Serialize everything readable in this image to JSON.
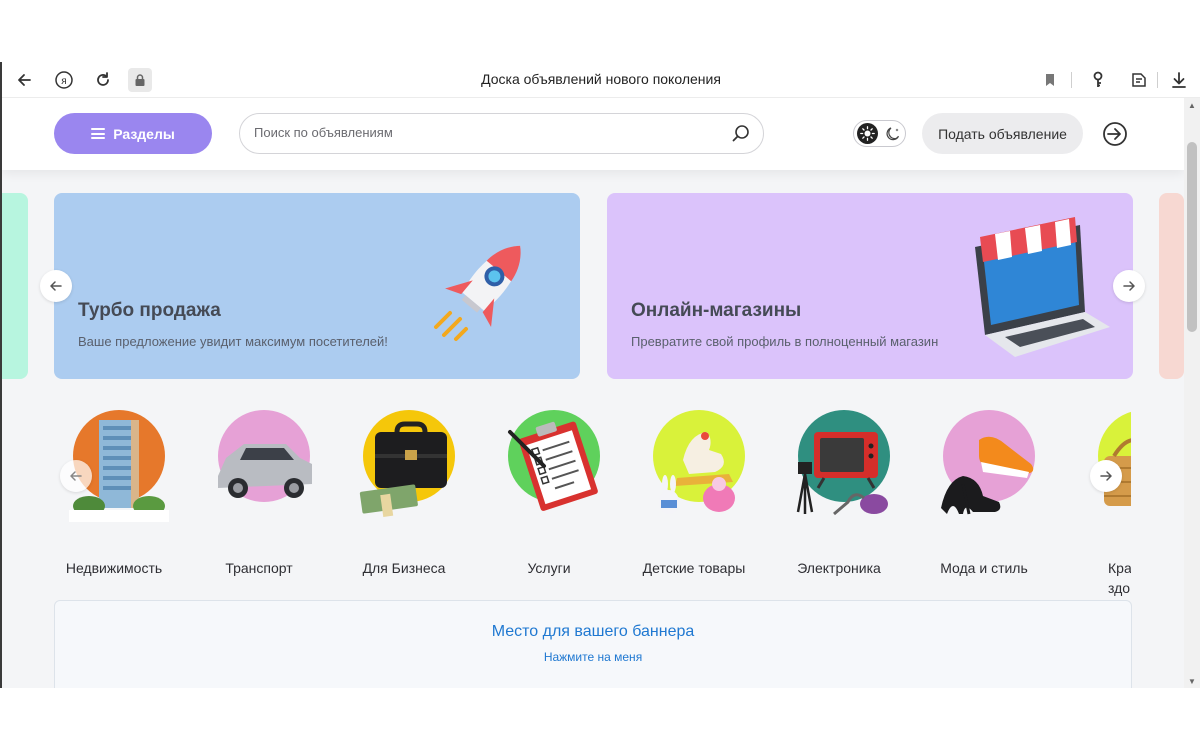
{
  "browser": {
    "title": "Доска объявлений нового поколения",
    "icons": [
      "back-arrow-icon",
      "yandex-icon",
      "reload-icon",
      "lock-icon",
      "bookmark-icon",
      "key-icon",
      "reader-mode-icon",
      "download-icon"
    ]
  },
  "header": {
    "sections_label": "Разделы",
    "search_placeholder": "Поиск по объявлениям",
    "post_label": "Подать объявление",
    "theme": "light"
  },
  "banners": [
    {
      "title": "Турбо продажа",
      "subtitle": "Ваше предложение увидит максимум посетителей!",
      "color": "#acccf0",
      "icon": "rocket-icon"
    },
    {
      "title": "Онлайн-магазины",
      "subtitle": "Превратите свой профиль в полноценный магазин",
      "color": "#dbc3fb",
      "icon": "laptop-store-icon"
    }
  ],
  "categories": [
    {
      "label": "Недвижимость",
      "icon": "building-icon",
      "color": "#e6782b"
    },
    {
      "label": "Транспорт",
      "icon": "car-icon",
      "color": "#e6a1d6"
    },
    {
      "label": "Для Бизнеса",
      "icon": "briefcase-icon",
      "color": "#f5c70a"
    },
    {
      "label": "Услуги",
      "icon": "clipboard-icon",
      "color": "#5fd15c"
    },
    {
      "label": "Детские товары",
      "icon": "toys-icon",
      "color": "#d9f23a"
    },
    {
      "label": "Электроника",
      "icon": "tv-icon",
      "color": "#2f8f80"
    },
    {
      "label": "Мода и стиль",
      "icon": "shoes-icon",
      "color": "#e6a1d6"
    },
    {
      "label": "Кра здо",
      "icon": "basket-icon",
      "color": "#d9f23a"
    }
  ],
  "ad_placeholder": {
    "title": "Место для вашего баннера",
    "subtitle": "Нажмите на меня"
  }
}
